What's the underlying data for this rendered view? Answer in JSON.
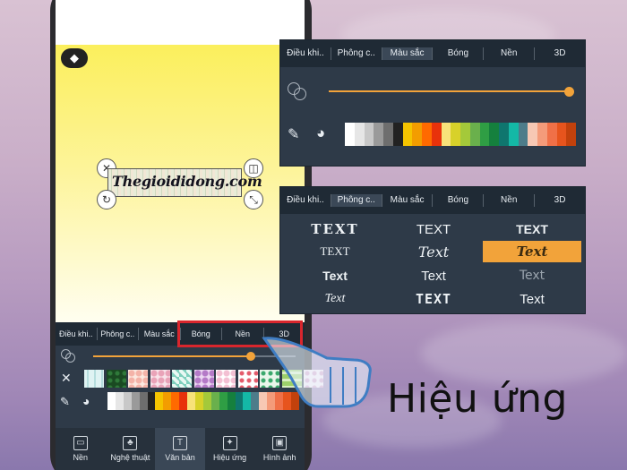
{
  "phone": {
    "canvas_text": "Thegioididong.com",
    "tabs": [
      "Điều khi..",
      "Phông c..",
      "Màu sắc",
      "Bóng",
      "Nền",
      "3D"
    ],
    "nav": [
      {
        "label": "Nền",
        "icon": "background-icon"
      },
      {
        "label": "Nghệ thuật",
        "icon": "art-icon"
      },
      {
        "label": "Văn bản",
        "icon": "text-icon"
      },
      {
        "label": "Hiệu ứng",
        "icon": "effects-icon"
      },
      {
        "label": "Hình ảnh",
        "icon": "image-icon"
      }
    ],
    "active_nav": 2,
    "slider_level": 0.78
  },
  "color_panel": {
    "tabs": [
      "Điều khi..",
      "Phông c..",
      "Màu sắc",
      "Bóng",
      "Nền",
      "3D"
    ],
    "selected_tab": 2,
    "slider_level": 1.0
  },
  "font_panel": {
    "tabs": [
      "Điều khi..",
      "Phông c..",
      "Màu sắc",
      "Bóng",
      "Nền",
      "3D"
    ],
    "selected_tab": 1,
    "fonts": [
      [
        "TEXT",
        "TEXT",
        "TEXT"
      ],
      [
        "TEXT",
        "Text",
        "Text"
      ],
      [
        "Text",
        "Text",
        "Text"
      ],
      [
        "Text",
        "TEXT",
        "Text"
      ]
    ],
    "selected_font": [
      1,
      2
    ]
  },
  "caption": "Hiệu ứng",
  "colors": {
    "accent": "#f2a33a",
    "panel": "#2e3a48",
    "highlight": "#d9262d"
  }
}
